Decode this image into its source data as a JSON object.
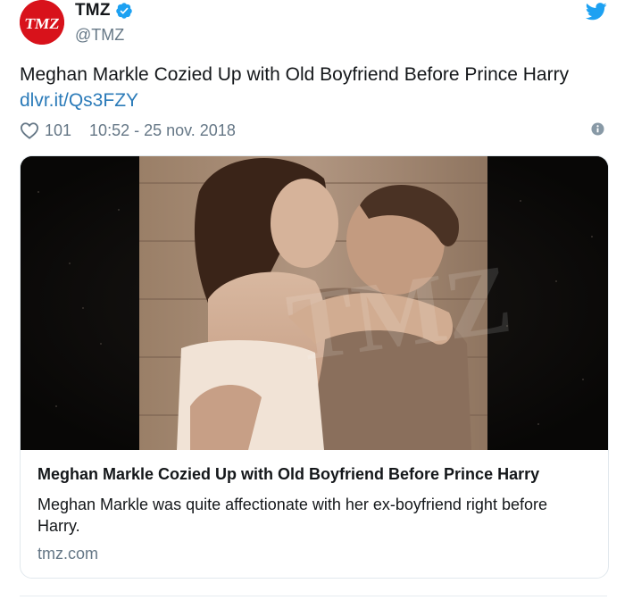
{
  "account": {
    "display_name": "TMZ",
    "handle": "@TMZ",
    "avatar_text": "TMZ",
    "verified": true,
    "verified_icon": "verified-badge-icon",
    "brand_color": "#d8121b"
  },
  "platform": {
    "icon": "twitter-bird-icon",
    "color": "#1da1f2"
  },
  "tweet": {
    "text": "Meghan Markle Cozied Up with Old Boyfriend Before Prince Harry",
    "link": "dlvr.it/Qs3FZY",
    "like_count": "101",
    "timestamp": "10:52 - 25 nov. 2018",
    "info_icon": "info-icon",
    "heart_icon": "heart-icon"
  },
  "card": {
    "image_watermark": "TMZ",
    "title": "Meghan Markle Cozied Up with Old Boyfriend Before Prince Harry",
    "description": "Meghan Markle was quite affectionate with her ex-boyfriend right before Harry.",
    "domain": "tmz.com"
  },
  "colors": {
    "link": "#2b7bb9",
    "secondary_text": "#657786",
    "border": "#e1e8ed"
  }
}
